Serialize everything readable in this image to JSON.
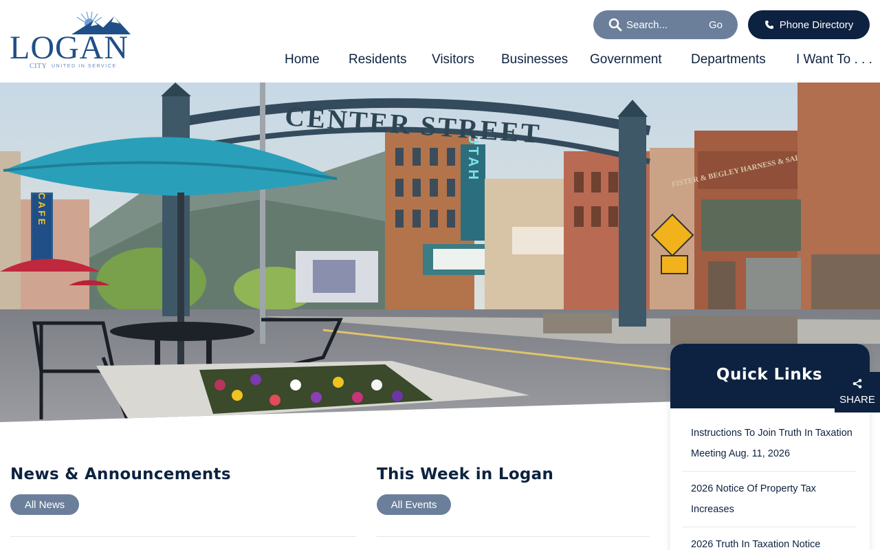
{
  "header": {
    "logo": {
      "word": "LOGAN",
      "city": "CITY",
      "tagline": "UNITED IN SERVICE"
    },
    "search": {
      "placeholder": "Search...",
      "go_label": "Go"
    },
    "phone_directory_label": "Phone Directory",
    "nav": [
      "Home",
      "Residents",
      "Visitors",
      "Businesses",
      "Government",
      "Departments",
      "I Want To . . ."
    ]
  },
  "hero": {
    "arch_text": "CENTER STREET",
    "signs": {
      "cafe": "CAFE",
      "utah": "UTAH",
      "saddlery": "FISTER & BEGLEY HARNESS & SADDLERY"
    }
  },
  "news": {
    "title": "News & Announcements",
    "button": "All News"
  },
  "events": {
    "title": "This Week in Logan",
    "button": "All Events"
  },
  "quick_links": {
    "title": "Quick Links",
    "items": [
      "Instructions To Join Truth In Taxation Meeting Aug. 11, 2026",
      "2026 Notice Of Property Tax Increases",
      "2026 Truth In Taxation Notice"
    ]
  },
  "share_label": "SHARE",
  "colors": {
    "navy": "#0d2240",
    "slate": "#6b7f9a",
    "logo_blue": "#1f4f86",
    "umbrella_teal": "#2a9fba"
  }
}
